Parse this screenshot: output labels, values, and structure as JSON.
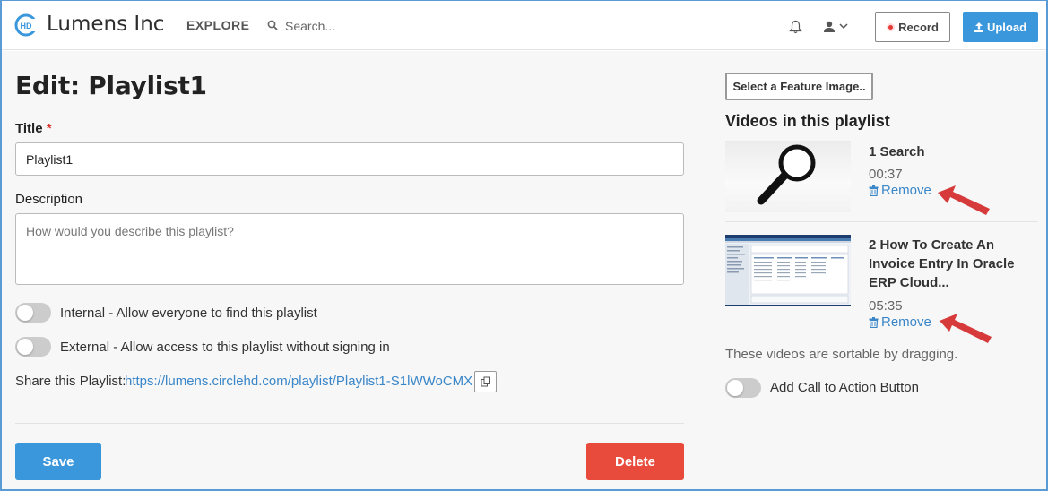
{
  "header": {
    "brand": "Lumens Inc",
    "logo_text": "HD",
    "nav_explore": "EXPLORE",
    "search_placeholder": "Search...",
    "record_label": "Record",
    "upload_label": "Upload"
  },
  "form": {
    "page_title": "Edit: Playlist1",
    "title_label": "Title",
    "title_required": "*",
    "title_value": "Playlist1",
    "description_label": "Description",
    "description_placeholder": "How would you describe this playlist?",
    "internal_toggle": {
      "label": "Internal - Allow everyone to find this playlist",
      "on": false
    },
    "external_toggle": {
      "label": "External - Allow access to this playlist without signing in",
      "on": false
    },
    "share_label": "Share this Playlist:",
    "share_url": "https://lumens.circlehd.com/playlist/Playlist1-S1lWWoCMX",
    "save_label": "Save",
    "delete_label": "Delete"
  },
  "sidebar": {
    "feature_image_button": "Select a Feature Image..",
    "videos_heading": "Videos in this playlist",
    "videos": [
      {
        "title_lines": [
          "1 Search"
        ],
        "duration": "00:37",
        "remove_label": "Remove",
        "thumb_icon": "magnifier-icon"
      },
      {
        "title_lines": [
          "2 How To Create An",
          "Invoice Entry In Oracle",
          "ERP Cloud..."
        ],
        "duration": "05:35",
        "remove_label": "Remove",
        "thumb_icon": "screenshot-thumbnail"
      }
    ],
    "sortable_note": "These videos are sortable by dragging.",
    "cta_toggle": {
      "label": "Add Call to Action Button",
      "on": false
    }
  },
  "colors": {
    "accent": "#3a97dc",
    "danger": "#e84b3c",
    "link": "#3a86c8",
    "annotation_arrow": "#d63a3a"
  }
}
